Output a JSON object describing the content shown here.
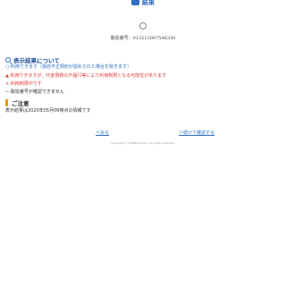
{
  "header": {
    "title": "結果"
  },
  "serial": {
    "text": "製造番号：013213007546330"
  },
  "about_section": {
    "title": "表示結果について",
    "lines": [
      "○:利用できます（独自不正契約が認められた場合を除きます）",
      "▲:利用できますが、代金債務の不履行等により利用制限となる可能性があります",
      "×:利用制限中です",
      "−:製造番号が確認できません"
    ]
  },
  "notice_section": {
    "title": "ご注意",
    "text": "表示結果は2020年05月06時点の情報です"
  },
  "links": {
    "back": "＜戻る",
    "continue": "＞続けて確認する"
  },
  "footer": {
    "copyright": "Copyright © SoftBank Corp. All rights reserved."
  },
  "colors": {
    "accent_blue": "#2f6fc4",
    "title_blue": "#1c4f93",
    "warning_red": "#e23d3d",
    "notice_orange": "#e69a00"
  }
}
